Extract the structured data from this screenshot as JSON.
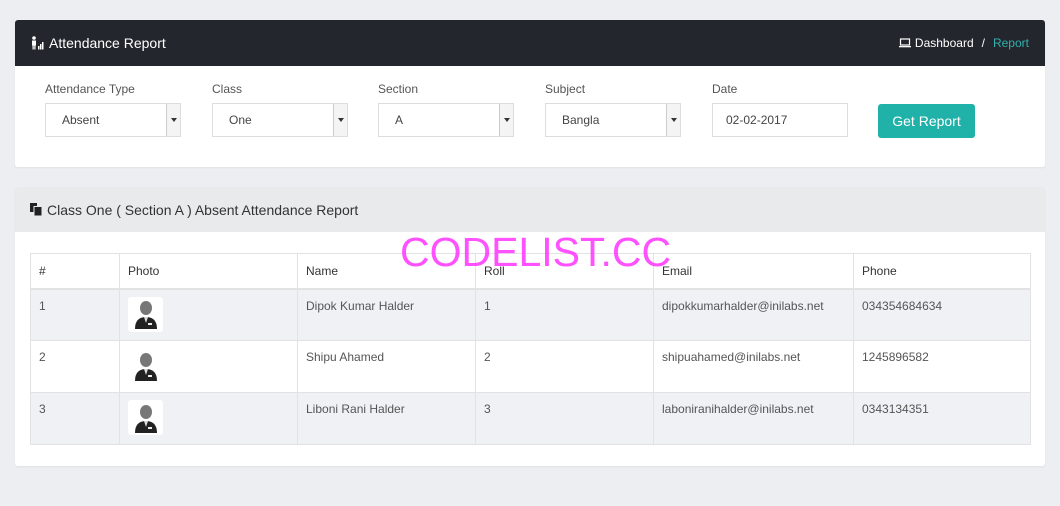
{
  "header": {
    "title": "Attendance Report",
    "breadcrumb": {
      "home": "Dashboard",
      "separator": "/",
      "current": "Report"
    }
  },
  "filters": {
    "attendance_type": {
      "label": "Attendance Type",
      "value": "Absent"
    },
    "class": {
      "label": "Class",
      "value": "One"
    },
    "section": {
      "label": "Section",
      "value": "A"
    },
    "subject": {
      "label": "Subject",
      "value": "Bangla"
    },
    "date": {
      "label": "Date",
      "value": "02-02-2017"
    },
    "submit_label": "Get Report"
  },
  "report": {
    "title": "Class One ( Section A ) Absent Attendance Report",
    "columns": [
      "#",
      "Photo",
      "Name",
      "Roll",
      "Email",
      "Phone"
    ],
    "rows": [
      {
        "num": "1",
        "name": "Dipok Kumar Halder",
        "roll": "1",
        "email": "dipokkumarhalder@inilabs.net",
        "phone": "034354684634"
      },
      {
        "num": "2",
        "name": "Shipu Ahamed",
        "roll": "2",
        "email": "shipuahamed@inilabs.net",
        "phone": "1245896582"
      },
      {
        "num": "3",
        "name": "Liboni Rani Halder",
        "roll": "3",
        "email": "laboniranihalder@inilabs.net",
        "phone": "0343134351"
      }
    ]
  },
  "watermark": "CODELIST.CC",
  "colors": {
    "header_bg": "#23272d",
    "accent": "#20b2a9",
    "breadcrumb_active": "#31b0ad",
    "watermark": "#ff33ff"
  }
}
